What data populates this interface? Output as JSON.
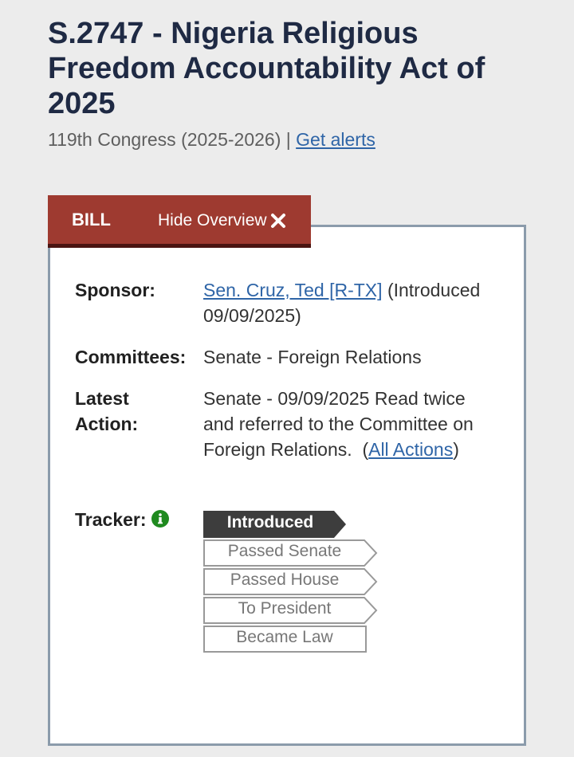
{
  "bill": {
    "title": "S.2747 - Nigeria Religious Freedom Accountability Act of 2025",
    "congress": "119th Congress (2025-2026)",
    "separator": "|",
    "alerts_link": "Get alerts"
  },
  "tabs": {
    "bill_label": "BILL",
    "hide_overview_label": "Hide Overview"
  },
  "overview": {
    "sponsor_label": "Sponsor:",
    "sponsor_name": "Sen. Cruz, Ted [R-TX]",
    "sponsor_intro": "(Introduced 09/09/2025)",
    "committees_label": "Committees:",
    "committees_value": "Senate - Foreign Relations",
    "latest_action_label_1": "Latest",
    "latest_action_label_2": "Action:",
    "latest_action_text": "Senate - 09/09/2025 Read twice and referred to the Committee on Foreign Relations.",
    "latest_action_open": "(",
    "all_actions_link": "All Actions",
    "latest_action_close": ")",
    "tracker_label": "Tracker:"
  },
  "tracker": {
    "steps": [
      "Introduced",
      "Passed Senate",
      "Passed House",
      "To President",
      "Became Law"
    ],
    "current_step": "Introduced"
  },
  "colors": {
    "tab_background": "#9e3a30",
    "title": "#1f2a44",
    "link": "#2f65a7",
    "tracker_current": "#3d3d3d",
    "info_icon": "#1f8a1f"
  },
  "icons": {
    "hide_overview": "close-icon",
    "tracker_info": "info-icon"
  }
}
